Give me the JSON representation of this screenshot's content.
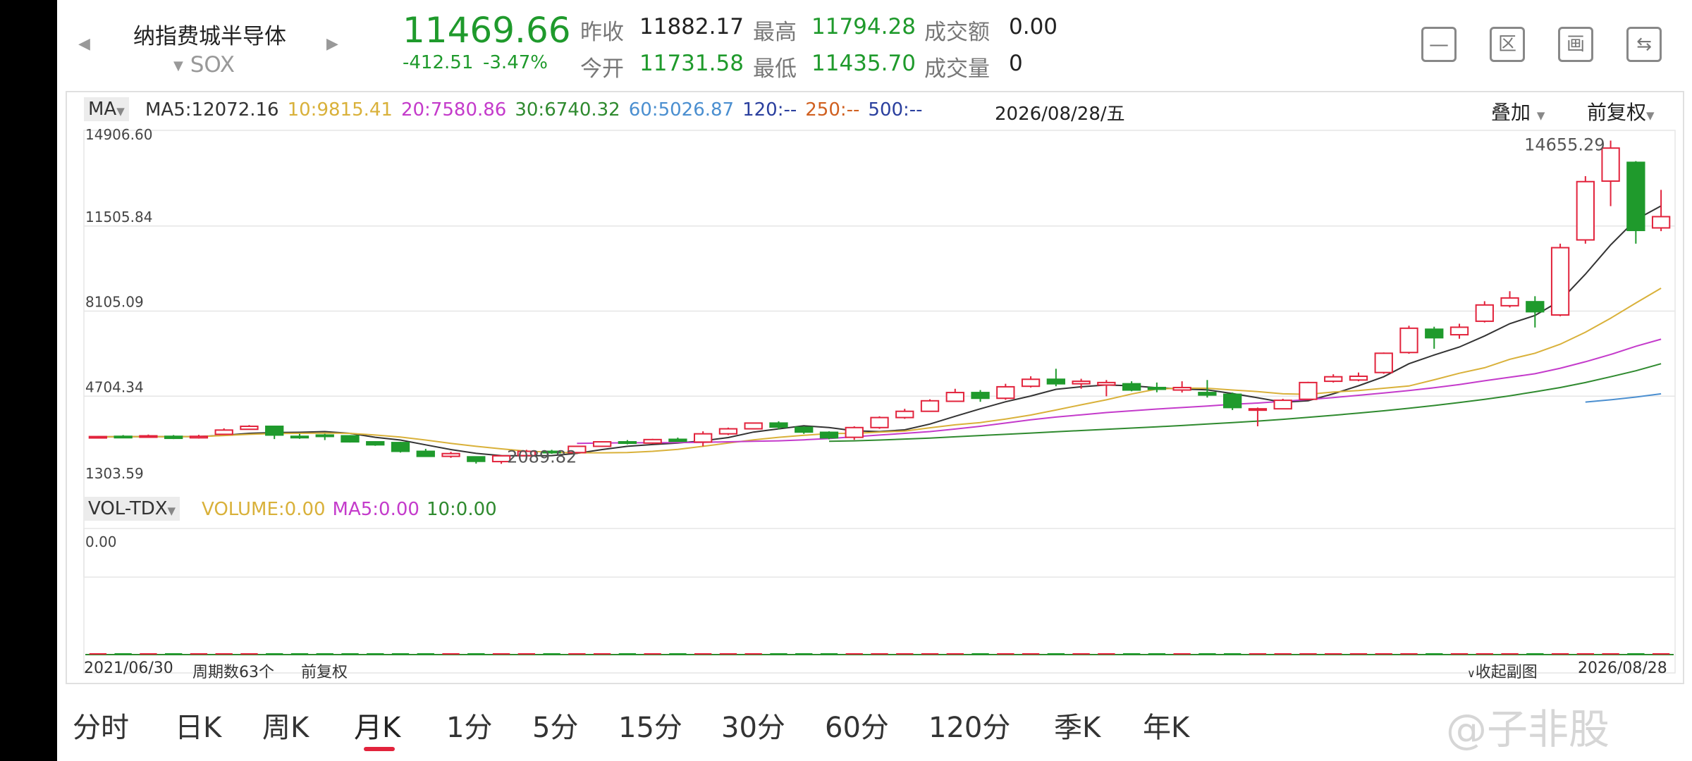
{
  "header": {
    "name": "纳指费城半导体",
    "code": "SOX",
    "price": "11469.66",
    "change": "-412.51",
    "change_pct": "-3.47%",
    "stats": [
      {
        "label": "昨收",
        "value": "11882.17"
      },
      {
        "label": "最高",
        "value": "11794.28"
      },
      {
        "label": "成交额",
        "value": "0.00"
      },
      {
        "label": "今开",
        "value": "11731.58"
      },
      {
        "label": "最低",
        "value": "11435.70"
      },
      {
        "label": "成交量",
        "value": "0"
      }
    ]
  },
  "indicator": {
    "name": "MA",
    "items": [
      {
        "label": "MA5:12072.16",
        "color": "#333333"
      },
      {
        "label": "10:9815.41",
        "color": "#d9b13a"
      },
      {
        "label": "20:7580.86",
        "color": "#c43bcb"
      },
      {
        "label": "30:6740.32",
        "color": "#2f8a2f"
      },
      {
        "label": "60:5026.87",
        "color": "#4b8fd0"
      },
      {
        "label": "120:--",
        "color": "#2a3f9e"
      },
      {
        "label": "250:--",
        "color": "#d06020"
      },
      {
        "label": "500:--",
        "color": "#2a3f9e"
      }
    ],
    "date": "2026/08/28/五",
    "overlay_label": "叠加",
    "adjust_label": "前复权"
  },
  "price_axis": [
    "14906.60",
    "11505.84",
    "8105.09",
    "4704.34",
    "1303.59"
  ],
  "annotations": {
    "high": "14655.29",
    "low": "2089.82"
  },
  "vol_indicator": {
    "name": "VOL-TDX",
    "items": [
      {
        "label": "VOLUME:0.00",
        "color": "#d9b13a"
      },
      {
        "label": "MA5:0.00",
        "color": "#c43bcb"
      },
      {
        "label": "10:0.00",
        "color": "#2f8a2f"
      }
    ],
    "axis_top": "0.00"
  },
  "footer": {
    "start_date": "2021/06/30",
    "period_count": "周期数63个",
    "adjust": "前复权",
    "collapse": "收起副图",
    "end_date": "2026/08/28"
  },
  "period_tabs": [
    {
      "label": "分时",
      "active": false
    },
    {
      "label": "日K",
      "active": false
    },
    {
      "label": "周K",
      "active": false
    },
    {
      "label": "月K",
      "active": true
    },
    {
      "label": "1分",
      "active": false
    },
    {
      "label": "5分",
      "active": false
    },
    {
      "label": "15分",
      "active": false
    },
    {
      "label": "30分",
      "active": false
    },
    {
      "label": "60分",
      "active": false
    },
    {
      "label": "120分",
      "active": false
    },
    {
      "label": "季K",
      "active": false
    },
    {
      "label": "年K",
      "active": false
    }
  ],
  "watermark": "@子非股",
  "colors": {
    "up": "#e2233c",
    "down": "#1f9a2c",
    "accent": "#e2233c"
  },
  "chart_data": {
    "type": "candlestick",
    "y_range": [
      1303.59,
      14906.6
    ],
    "x_range": [
      "2021/06/30",
      "2026/08/28"
    ],
    "period": "monthly",
    "candles": [
      [
        3080,
        3090,
        3050,
        3110
      ],
      [
        3100,
        3090,
        3040,
        3150
      ],
      [
        3090,
        3120,
        3070,
        3170
      ],
      [
        3100,
        3020,
        2990,
        3150
      ],
      [
        3040,
        3100,
        3010,
        3160
      ],
      [
        3180,
        3350,
        3160,
        3420
      ],
      [
        3380,
        3500,
        3360,
        3550
      ],
      [
        3500,
        3150,
        2990,
        3520
      ],
      [
        3100,
        3080,
        3000,
        3200
      ],
      [
        3150,
        3110,
        2950,
        3200
      ],
      [
        3120,
        2880,
        2850,
        3150
      ],
      [
        2880,
        2760,
        2720,
        2900
      ],
      [
        2850,
        2500,
        2450,
        2880
      ],
      [
        2500,
        2300,
        2280,
        2600
      ],
      [
        2300,
        2410,
        2240,
        2480
      ],
      [
        2280,
        2100,
        2010,
        2300
      ],
      [
        2090,
        2320,
        2000,
        2350
      ],
      [
        2330,
        2500,
        2290,
        2560
      ],
      [
        2500,
        2450,
        2400,
        2560
      ],
      [
        2450,
        2700,
        2420,
        2720
      ],
      [
        2700,
        2880,
        2680,
        2900
      ],
      [
        2880,
        2830,
        2780,
        2950
      ],
      [
        2830,
        2970,
        2800,
        3000
      ],
      [
        2980,
        2900,
        2880,
        3050
      ],
      [
        2870,
        3200,
        2700,
        3300
      ],
      [
        3200,
        3400,
        3150,
        3450
      ],
      [
        3400,
        3630,
        3380,
        3650
      ],
      [
        3630,
        3470,
        3380,
        3700
      ],
      [
        3460,
        3270,
        3200,
        3490
      ],
      [
        3260,
        3040,
        2980,
        3300
      ],
      [
        3060,
        3450,
        2960,
        3500
      ],
      [
        3450,
        3850,
        3400,
        3900
      ],
      [
        3850,
        4100,
        3800,
        4200
      ],
      [
        4100,
        4520,
        4080,
        4580
      ],
      [
        4500,
        4850,
        4480,
        5000
      ],
      [
        4850,
        4620,
        4480,
        4950
      ],
      [
        4620,
        5080,
        4560,
        5200
      ],
      [
        5100,
        5380,
        5050,
        5500
      ],
      [
        5380,
        5200,
        5100,
        5800
      ],
      [
        5200,
        5300,
        5000,
        5400
      ],
      [
        5150,
        5250,
        4700,
        5350
      ],
      [
        5200,
        4950,
        4900,
        5300
      ],
      [
        5050,
        4980,
        4860,
        5250
      ],
      [
        4950,
        5050,
        4850,
        5300
      ],
      [
        4850,
        4750,
        4650,
        5350
      ],
      [
        4780,
        4250,
        4150,
        4850
      ],
      [
        4150,
        4200,
        3500,
        4250
      ],
      [
        4200,
        4540,
        4180,
        4600
      ],
      [
        4580,
        5250,
        4550,
        5280
      ],
      [
        5300,
        5480,
        5250,
        5580
      ],
      [
        5350,
        5500,
        5300,
        5650
      ],
      [
        5650,
        6420,
        5600,
        6450
      ],
      [
        6450,
        7420,
        6400,
        7520
      ],
      [
        7380,
        7040,
        6600,
        7480
      ],
      [
        7160,
        7460,
        7000,
        7600
      ],
      [
        7700,
        8350,
        7650,
        8500
      ],
      [
        8320,
        8630,
        8250,
        8900
      ],
      [
        8480,
        8080,
        7450,
        8700
      ],
      [
        7950,
        10640,
        7900,
        10800
      ],
      [
        10950,
        13280,
        10800,
        13500
      ],
      [
        13300,
        14620,
        12300,
        14920
      ],
      [
        14050,
        11330,
        10800,
        14100
      ],
      [
        11430,
        11880,
        11300,
        12950
      ]
    ],
    "ma": {
      "MA5": {
        "color": "#333333",
        "start_index": 0,
        "values": [
          3080,
          3085,
          3090,
          3085,
          3090,
          3140,
          3220,
          3250,
          3260,
          3290,
          3220,
          3060,
          2950,
          2760,
          2570,
          2420,
          2330,
          2320,
          2330,
          2420,
          2570,
          2700,
          2770,
          2830,
          2920,
          3050,
          3270,
          3400,
          3520,
          3450,
          3320,
          3290,
          3360,
          3590,
          3900,
          4200,
          4480,
          4710,
          4980,
          5080,
          5150,
          5120,
          5040,
          4990,
          4960,
          4810,
          4640,
          4460,
          4520,
          4800,
          5120,
          5480,
          6000,
          6350,
          6670,
          7110,
          7600,
          7930,
          8520,
          9580,
          10750,
          11760,
          12310
        ]
      },
      "MA10": {
        "color": "#d9b13a",
        "start_index": 0,
        "values": [
          3080,
          3085,
          3090,
          3085,
          3090,
          3130,
          3180,
          3210,
          3220,
          3230,
          3220,
          3150,
          3070,
          2950,
          2820,
          2700,
          2600,
          2510,
          2460,
          2440,
          2440,
          2450,
          2500,
          2580,
          2700,
          2830,
          2960,
          3060,
          3140,
          3210,
          3220,
          3270,
          3310,
          3440,
          3560,
          3650,
          3790,
          3950,
          4150,
          4360,
          4560,
          4790,
          4990,
          5030,
          5020,
          4950,
          4890,
          4800,
          4780,
          4870,
          4930,
          5020,
          5110,
          5360,
          5620,
          5840,
          6180,
          6420,
          6780,
          7260,
          7820,
          8430,
          9020
        ]
      },
      "MA20": {
        "color": "#c43bcb",
        "start_index": 19,
        "values": [
          2820,
          2830,
          2840,
          2840,
          2850,
          2860,
          2880,
          2900,
          2920,
          2960,
          3010,
          3080,
          3150,
          3220,
          3290,
          3390,
          3500,
          3630,
          3760,
          3870,
          3960,
          4050,
          4120,
          4190,
          4250,
          4310,
          4380,
          4430,
          4500,
          4570,
          4650,
          4740,
          4830,
          4930,
          5040,
          5170,
          5320,
          5460,
          5600,
          5820,
          6080,
          6370,
          6700,
          6980
        ]
      },
      "MA30": {
        "color": "#2f8a2f",
        "start_index": 29,
        "values": [
          2900,
          2920,
          2950,
          2990,
          3030,
          3080,
          3130,
          3180,
          3230,
          3280,
          3330,
          3380,
          3430,
          3480,
          3530,
          3590,
          3650,
          3710,
          3780,
          3860,
          3940,
          4030,
          4120,
          4220,
          4330,
          4450,
          4580,
          4720,
          4880,
          5050,
          5250,
          5480,
          5720,
          6000
        ]
      },
      "MA60": {
        "color": "#4b8fd0",
        "start_index": 59,
        "values": [
          4470,
          4560,
          4670,
          4800
        ]
      }
    }
  },
  "volume_data": {
    "type": "bar",
    "values": [
      0,
      0,
      0
    ]
  }
}
